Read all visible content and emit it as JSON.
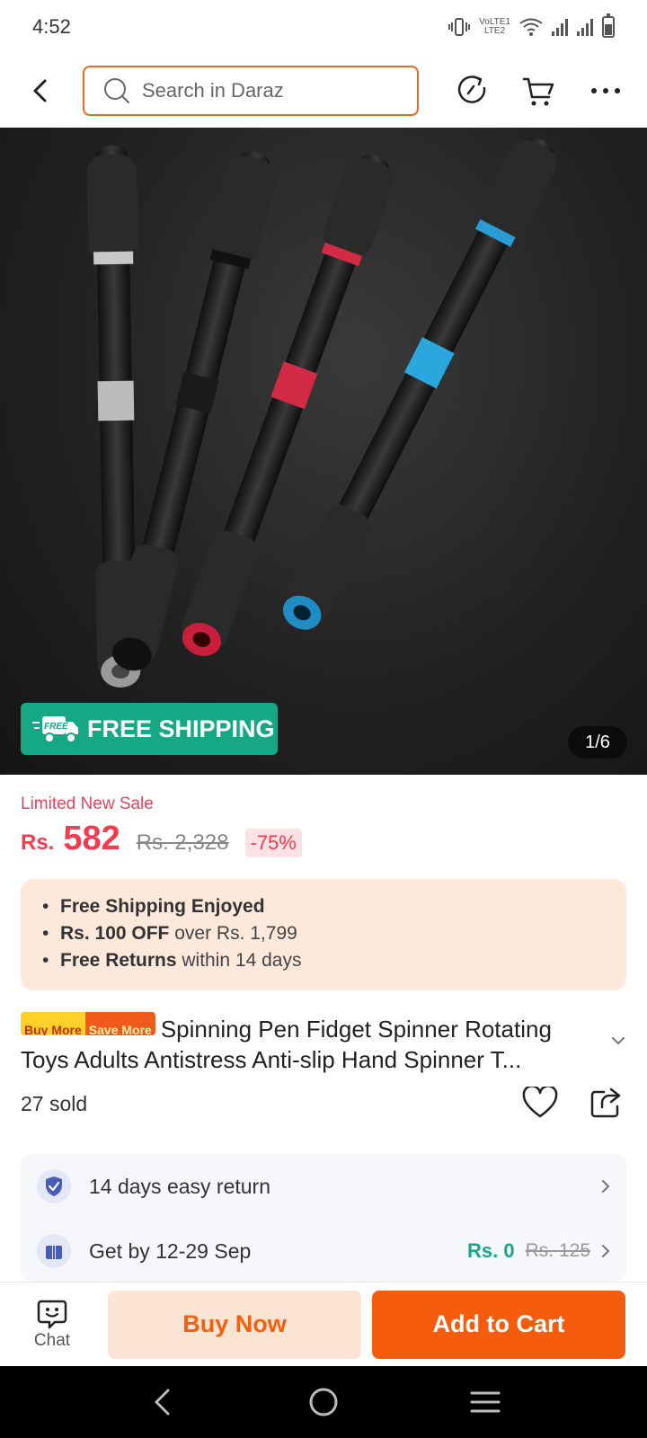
{
  "status_bar": {
    "time": "4:52",
    "volte_line1": "VoLTE1",
    "volte_line2": "LTE2"
  },
  "search": {
    "placeholder": "Search in Daraz"
  },
  "hero": {
    "free_shipping_label": "FREE SHIPPING",
    "free_badge_small": "FREE",
    "page_indicator": "1/6"
  },
  "price": {
    "sale_label": "Limited New Sale",
    "currency": "Rs.",
    "current": "582",
    "original": "Rs. 2,328",
    "discount": "-75%"
  },
  "benefits": [
    {
      "bold": "Free Shipping Enjoyed",
      "rest": ""
    },
    {
      "bold": "Rs. 100 OFF",
      "rest": " over Rs. 1,799"
    },
    {
      "bold": "Free Returns",
      "rest": " within 14 days"
    }
  ],
  "product": {
    "tag_a": "Buy More",
    "tag_b": "Save More",
    "title": "Spinning Pen Fidget Spinner Rotating Toys Adults Antistress Anti-slip Hand Spinner T...",
    "sold": "27 sold"
  },
  "services": {
    "returns": "14 days easy return",
    "delivery": "Get by 12-29 Sep",
    "shipping_fee": "Rs. 0",
    "shipping_fee_original": "Rs. 125"
  },
  "actions": {
    "chat": "Chat",
    "buy_now": "Buy Now",
    "add_to_cart": "Add to Cart"
  },
  "colors": {
    "accent": "#f65c0e",
    "price": "#f43b4f",
    "free_shipping": "#16a884",
    "search_border": "#e66a1f"
  }
}
